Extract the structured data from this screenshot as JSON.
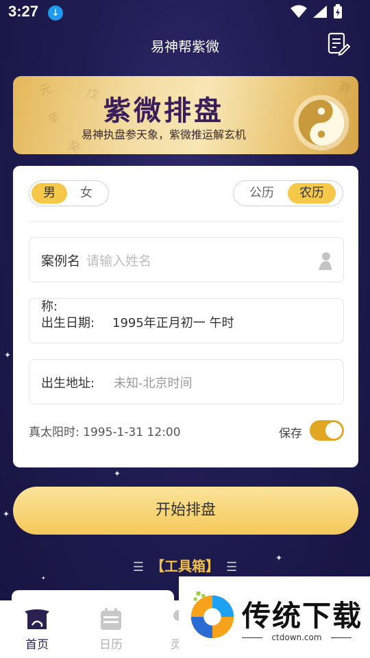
{
  "status_bar": {
    "time": "3:27"
  },
  "header": {
    "title": "易神帮紫微"
  },
  "banner": {
    "title": "紫微排盘",
    "subtitle": "易神执盘参天象，紫微推运解玄机",
    "glyphs": [
      "元",
      "戊",
      "辛",
      "癸",
      "弄",
      "天"
    ]
  },
  "form": {
    "gender": {
      "options": [
        "男",
        "女"
      ],
      "selected": "男"
    },
    "calendar": {
      "options": [
        "公历",
        "农历"
      ],
      "selected": "农历"
    },
    "case_name": {
      "label": "案例名",
      "placeholder": "请输入姓名"
    },
    "birth_date": {
      "label_wrap": "称:",
      "label": "出生日期:",
      "value": "1995年正月初一 午时"
    },
    "birth_place": {
      "label": "出生地址:",
      "value": "未知-北京时间"
    },
    "true_solar_time": "真太阳时: 1995-1-31 12:00",
    "save_label": "保存",
    "save_enabled": true
  },
  "start_button": "开始排盘",
  "toolbox": {
    "bars": "☰",
    "title": "【工具箱】"
  },
  "bottom_nav": [
    {
      "label": "首页",
      "icon": "home-icon",
      "active": true
    },
    {
      "label": "日历",
      "icon": "calendar-icon",
      "active": false
    },
    {
      "label": "灵",
      "icon": "spirit-icon",
      "active": false
    }
  ],
  "watermark": {
    "brand": "传统下载",
    "url": "ctdown.com"
  },
  "colors": {
    "accent": "#f5c84a",
    "toggle": "#e1a722",
    "background": "#1f1c52",
    "nav_active": "#2b2150"
  }
}
